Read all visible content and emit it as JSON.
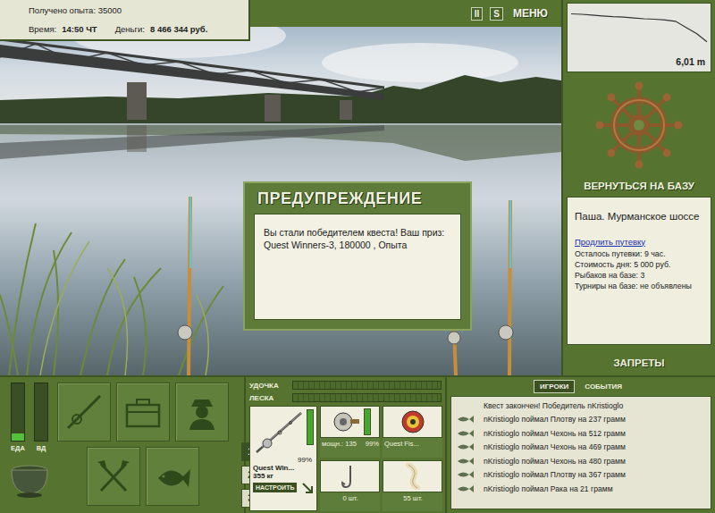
{
  "stats": {
    "experience": "Получено опыта: 35000",
    "time_label": "Время:",
    "time": "14:50 ЧТ",
    "money_label": "Деньги:",
    "money": "8 466 344 руб."
  },
  "toolbar": [
    {
      "label": "II"
    },
    {
      "label": "S"
    },
    {
      "label": "МЕНЮ"
    }
  ],
  "dialog": {
    "title": "ПРЕДУПРЕЖДЕНИЕ",
    "message": "Вы стали победителем квеста! Ваш приз: Quest Winners-3, 180000 , Опыта"
  },
  "depth_chart": {
    "values": [
      5.72,
      5.73,
      5.75,
      5.77,
      5.79,
      5.8,
      5.82,
      5.84,
      5.85,
      5.87,
      5.9,
      6.05,
      6.2,
      6.4
    ],
    "reading": "6,01 m"
  },
  "base": {
    "return_label": "ВЕРНУТЬСЯ НА БАЗУ",
    "name": "Паша. Мурманское шоссе",
    "extend_link": "Продлить путевку",
    "lines": [
      "Осталось путевки: 9 час.",
      "Стоимость дня: 5 000 руб.",
      "Рыбаков на базе: 3",
      "Турниры на базе: не объявлены"
    ]
  },
  "bans_label": "ЗАПРЕТЫ",
  "needs": [
    {
      "label": "ЕДА",
      "level": 0.12
    },
    {
      "label": "ВД",
      "level": 0
    }
  ],
  "slots": [
    {
      "label": "1",
      "selected": true
    },
    {
      "label": "2",
      "selected": false
    },
    {
      "label": "3",
      "selected": false
    }
  ],
  "tension": [
    {
      "label": "УДОЧКА",
      "level": 0
    },
    {
      "label": "ЛЕСКА",
      "level": 0
    }
  ],
  "tackle": {
    "rod": {
      "name": "Quest Win...",
      "weight": "355 кг",
      "level": 0.99,
      "reading": "99%"
    },
    "setup_button": "НАСТРОИТЬ",
    "reel": {
      "power": "мощн.: 135",
      "level": 0.99,
      "reading": "99%"
    },
    "line": {
      "name": "Quest Fis..."
    },
    "hook": {
      "count": "0 шт."
    },
    "bait": {
      "count": "55 шт."
    }
  },
  "feed": {
    "tabs": [
      {
        "label": "ИГРОКИ",
        "selected": true
      },
      {
        "label": "СОБЫТИЯ",
        "selected": false
      }
    ],
    "messages": [
      {
        "text": "Квест закончен! Победитель nKristioglo",
        "kind": "notice"
      },
      {
        "text": "nKristioglo поймал Плотву на 237 грамм",
        "kind": "catch"
      },
      {
        "text": "nKristioglo поймал Чехонь на 512 грамм",
        "kind": "catch"
      },
      {
        "text": "nKristioglo поймал Чехонь на 469 грамм",
        "kind": "catch"
      },
      {
        "text": "nKristioglo поймал Чехонь на 480 грамм",
        "kind": "catch"
      },
      {
        "text": "nKristioglo поймал Плотву на 367 грамм",
        "kind": "catch"
      },
      {
        "text": "nKristioglo поймал Рака на 21 грамм",
        "kind": "catch"
      }
    ]
  }
}
